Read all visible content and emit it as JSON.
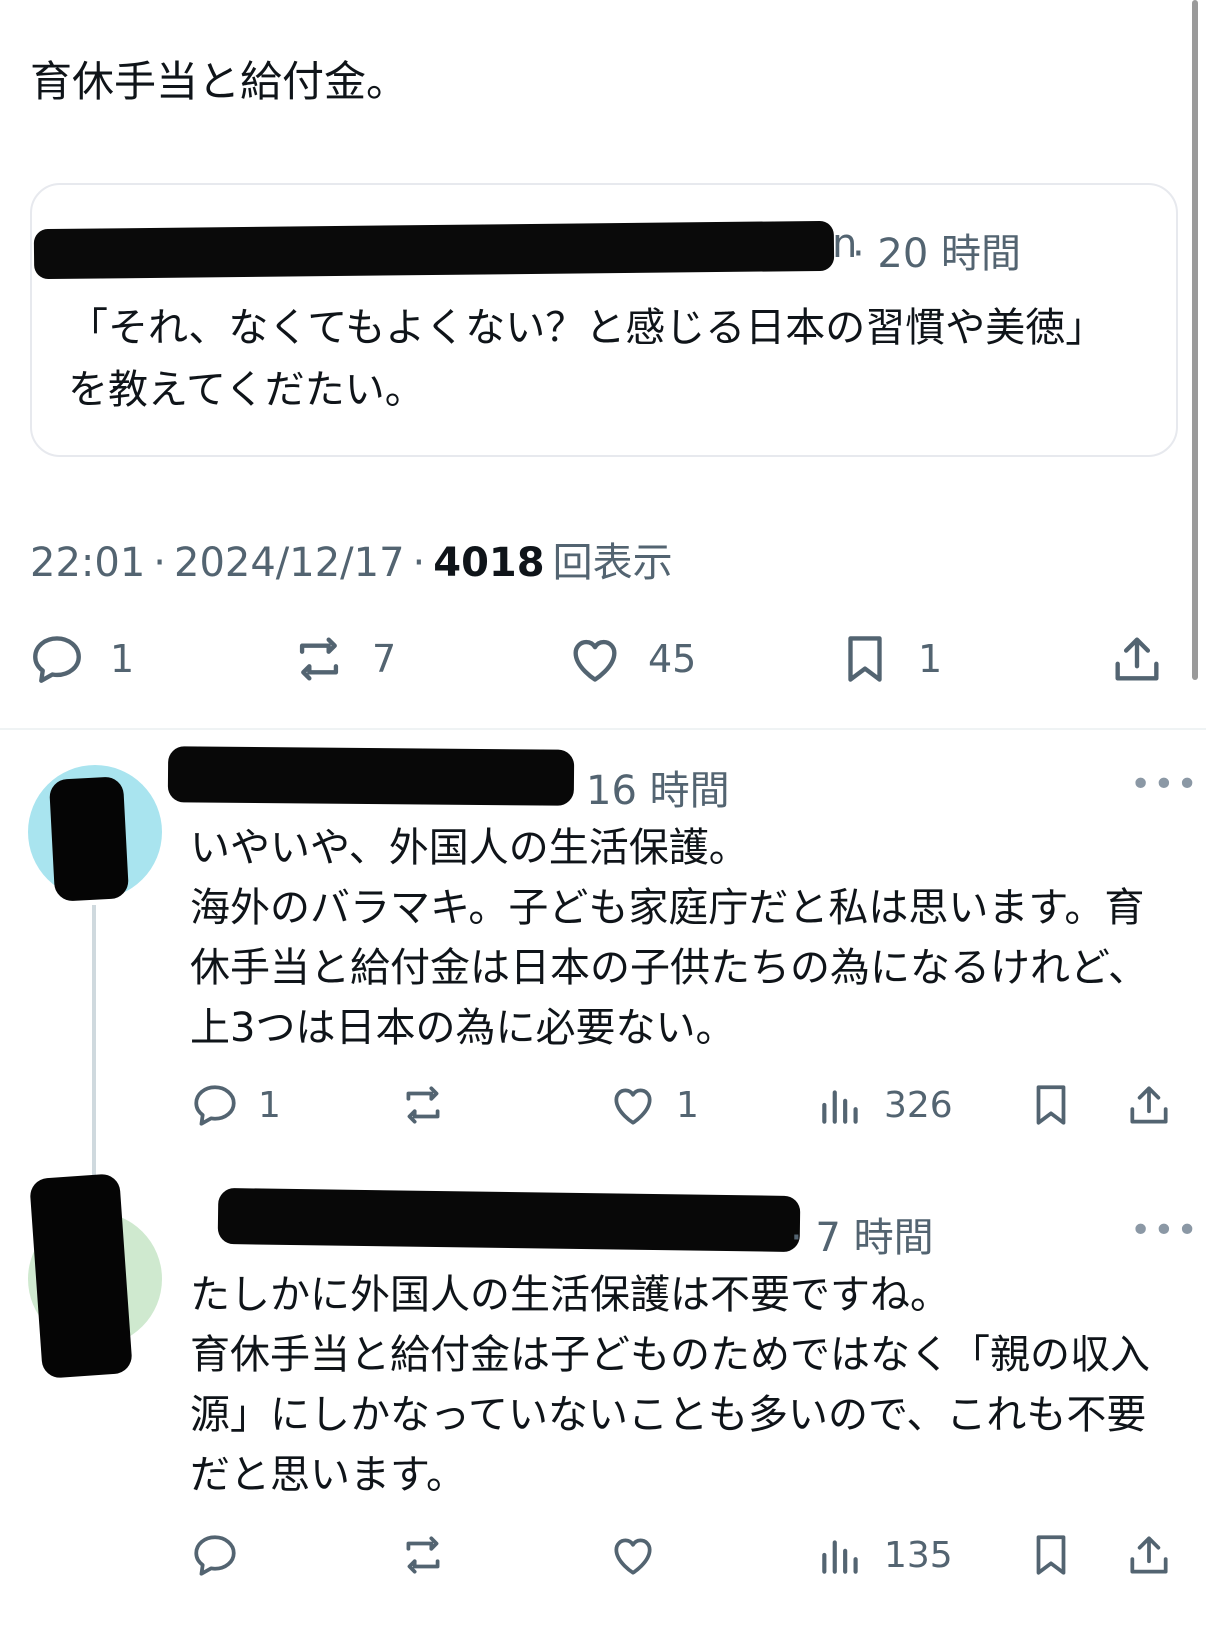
{
  "main_tweet": {
    "text": "育休手当と給付金。",
    "quote": {
      "handle_tail": "n",
      "time": "· 20 時間",
      "text": "「それ、なくてもよくない？と感じる日本の習慣や美徳」を教えてくだたい。"
    },
    "meta": {
      "time": "22:01",
      "sep1": "·",
      "date": "2024/12/17",
      "sep2": "·",
      "views_count": "4018",
      "views_label": "回表示"
    },
    "actions": {
      "reply_count": "1",
      "retweet_count": "7",
      "like_count": "45",
      "bookmark_count": "1"
    }
  },
  "replies": [
    {
      "time": "16 時間",
      "more": "•••",
      "text": "いやいや、外国人の生活保護。\n海外のバラマキ。子ども家庭庁だと私は思います。育休手当と給付金は日本の子供たちの為になるけれど、上3つは日本の為に必要ない。",
      "reply_count": "1",
      "retweet_count": "",
      "like_count": "1",
      "views_count": "326"
    },
    {
      "time": "· 7 時間",
      "more": "•••",
      "text": "たしかに外国人の生活保護は不要ですね。\n育休手当と給付金は子どものためではなく「親の収入源」にしかなっていないことも多いので、これも不要だと思います。",
      "reply_count": "",
      "retweet_count": "",
      "like_count": "",
      "views_count": "135"
    }
  ],
  "colors": {
    "text": "#0f1419",
    "secondary": "#536471",
    "border": "#e7e9ee",
    "avatar_1_bg": "#a9e4ef",
    "avatar_2_bg": "#cfe9cf"
  },
  "icons": [
    "reply-icon",
    "retweet-icon",
    "like-icon",
    "bookmark-icon",
    "share-icon",
    "views-icon",
    "more-icon"
  ]
}
